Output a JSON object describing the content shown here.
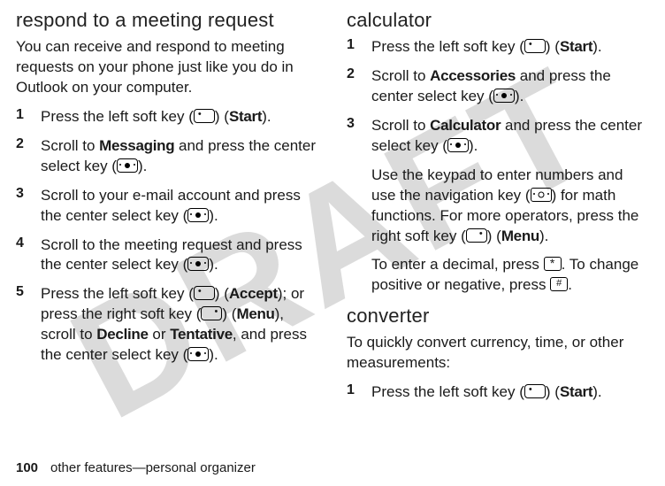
{
  "watermark": "DRAFT",
  "left": {
    "heading": "respond to a meeting request",
    "intro": "You can receive and respond to meeting requests on your phone just like you do in Outlook on your computer.",
    "steps": [
      {
        "n": "1",
        "pre": "Press the left soft key (",
        "post": ") (",
        "label": "Start",
        "tail": ")."
      },
      {
        "n": "2",
        "pre": "Scroll to ",
        "mid": "Messaging",
        "rest": " and press the center select key (",
        "tail": ")."
      },
      {
        "n": "3",
        "text": "Scroll to your e-mail account and press the center select key (",
        "tail": ")."
      },
      {
        "n": "4",
        "text": "Scroll to the meeting request and press the center select key (",
        "tail": ")."
      },
      {
        "n": "5",
        "a": "Press the left soft key (",
        "accept": "Accept",
        "b": "); or press the right soft key (",
        "menu": "Menu",
        "c": "), scroll to  ",
        "decline": "Decline",
        "or": " or ",
        "tentative": "Tentative",
        "d": ", and press the center select key (",
        "tail": ")."
      }
    ]
  },
  "right": {
    "calc_heading": "calculator",
    "calc_steps": [
      {
        "n": "1",
        "pre": "Press the left soft key (",
        "label": "Start",
        "tail": ")."
      },
      {
        "n": "2",
        "pre": "Scroll to ",
        "mid": "Accessories",
        "rest": " and press the center select key (",
        "tail": ")."
      },
      {
        "n": "3",
        "pre": "Scroll to ",
        "mid": "Calculator",
        "rest": " and press the center select key (",
        "tail": ")."
      }
    ],
    "calc_note1a": "Use the keypad to enter numbers and use the navigation key (",
    "calc_note1b": ") for math functions. For more operators, press the right soft key (",
    "calc_note1_menu": "Menu",
    "calc_note1c": ").",
    "calc_note2a": "To enter a decimal, press ",
    "calc_note2b": ". To change positive or negative, press ",
    "calc_note2c": ".",
    "conv_heading": "converter",
    "conv_intro": "To quickly convert currency, time, or other measurements:",
    "conv_step1_pre": "Press the left soft key (",
    "conv_step1_label": "Start",
    "conv_step1_tail": ")."
  },
  "footer": {
    "page": "100",
    "text": "other features—personal organizer"
  }
}
